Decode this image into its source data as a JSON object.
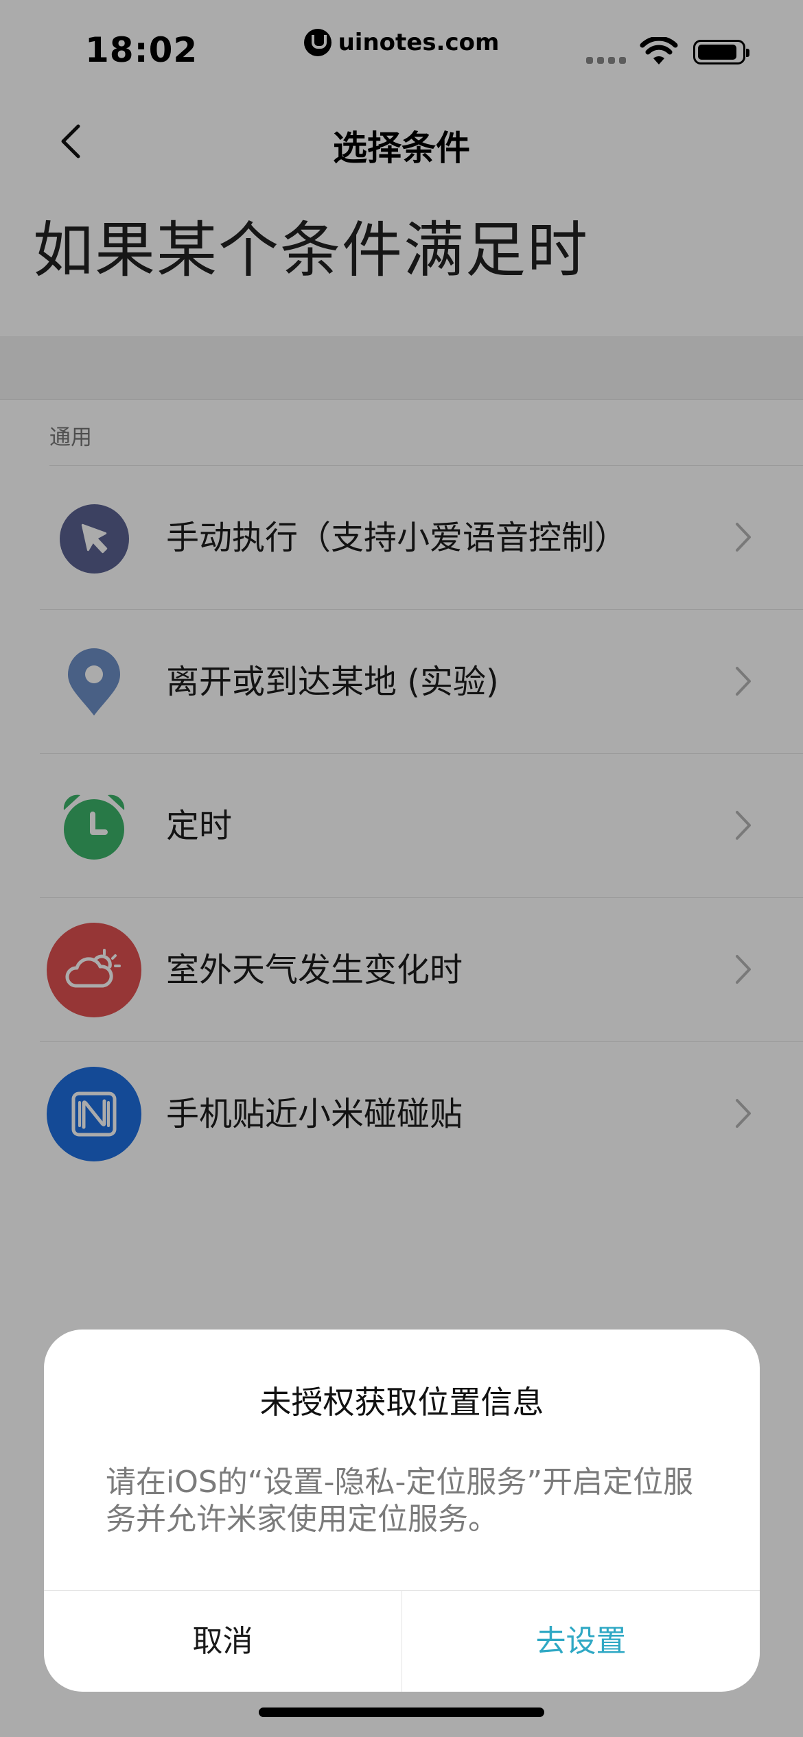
{
  "status_bar": {
    "time": "18:02",
    "url_pill": "uinotes.com"
  },
  "nav": {
    "title": "选择条件"
  },
  "heading": "如果某个条件满足时",
  "section": {
    "label": "通用"
  },
  "items": [
    {
      "label": "手动执行（支持小爱语音控制）",
      "icon": "pointer-icon",
      "color": "#5a6191"
    },
    {
      "label": "离开或到达某地 (实验)",
      "icon": "location-pin-icon",
      "color": "#6d8fc6"
    },
    {
      "label": "定时",
      "icon": "alarm-clock-icon",
      "color": "#3db56a"
    },
    {
      "label": "室外天气发生变化时",
      "icon": "weather-icon",
      "color": "#e05151"
    },
    {
      "label": "手机贴近小米碰碰贴",
      "icon": "nfc-icon",
      "color": "#1f6fe0"
    }
  ],
  "dialog": {
    "title": "未授权获取位置信息",
    "message": "请在iOS的“设置-隐私-定位服务”开启定位服务并允许米家使用定位服务。",
    "cancel": "取消",
    "confirm": "去设置",
    "confirm_color": "#2fa8c4"
  }
}
